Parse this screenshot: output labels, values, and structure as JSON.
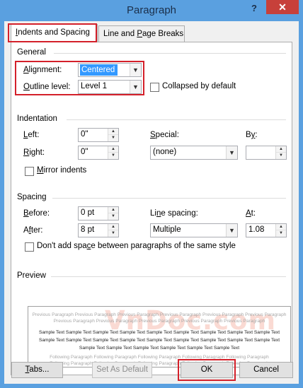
{
  "window": {
    "title": "Paragraph",
    "help_glyph": "?",
    "close_glyph": "✕"
  },
  "tabs": [
    {
      "label": "Indents and Spacing",
      "mnemonic": "I",
      "rest": "ndents and Spacing",
      "active": true
    },
    {
      "label": "Line and Page Breaks",
      "pre": "Line and ",
      "mnemonic": "P",
      "rest": "age Breaks",
      "active": false
    }
  ],
  "general": {
    "title": "General",
    "alignment_label": "Alignment:",
    "alignment_value": "Centered",
    "outline_label": "Outline level:",
    "outline_value": "Level 1",
    "collapsed_label": "Collapsed by default",
    "collapsed_checked": false
  },
  "indentation": {
    "title": "Indentation",
    "left_label": "Left:",
    "left_value": "0\"",
    "right_label": "Right:",
    "right_value": "0\"",
    "special_label": "Special:",
    "special_value": "(none)",
    "by_label": "By:",
    "by_value": "",
    "mirror_label": "Mirror indents",
    "mirror_checked": false
  },
  "spacing": {
    "title": "Spacing",
    "before_label": "Before:",
    "before_value": "0 pt",
    "after_label": "After:",
    "after_value": "8 pt",
    "line_spacing_label": "Line spacing:",
    "line_spacing_value": "Multiple",
    "at_label": "At:",
    "at_value": "1.08",
    "dont_add_label": "Don't add space between paragraphs of the same style",
    "dont_add_checked": false
  },
  "preview": {
    "title": "Preview",
    "previous_lines": [
      "Previous Paragraph Previous Paragraph Previous Paragraph Previous Paragraph Previous Paragraph Previous Paragraph",
      "Previous Paragraph Previous Paragraph Previous Paragraph Previous Paragraph Previous Paragraph"
    ],
    "sample_lines": [
      "Sample Text Sample Text Sample Text Sample Text Sample Text Sample Text Sample Text Sample Text Sample Text",
      "Sample Text Sample Text Sample Text Sample Text Sample Text Sample Text Sample Text Sample Text Sample Text",
      "Sample Text Sample Text Sample Text Sample Text Sample Text Sample Text"
    ],
    "following_lines": [
      "Following Paragraph Following Paragraph Following Paragraph Following Paragraph Following Paragraph",
      "Following Paragraph Following Paragraph Following Paragraph Following Paragraph Following Paragraph"
    ],
    "watermark": "VnDoc.com"
  },
  "buttons": {
    "tabs": "Tabs...",
    "set_default": "Set As Default",
    "ok": "OK",
    "cancel": "Cancel"
  },
  "colors": {
    "highlight": "#d4202a",
    "titlebar": "#5aa0e0",
    "close": "#c7403a",
    "selection": "#3399ff"
  }
}
